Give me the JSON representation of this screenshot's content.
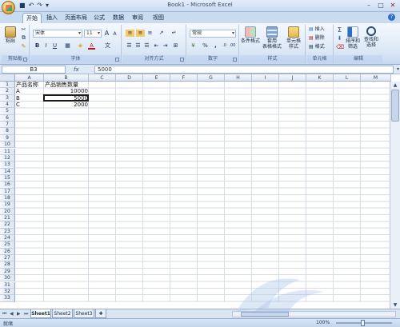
{
  "window": {
    "title": "Book1 - Microsoft Excel"
  },
  "tabs": [
    {
      "label": "开始",
      "active": true
    },
    {
      "label": "插入"
    },
    {
      "label": "页面布局"
    },
    {
      "label": "公式"
    },
    {
      "label": "数据"
    },
    {
      "label": "审阅"
    },
    {
      "label": "视图"
    }
  ],
  "ribbon": {
    "clipboard": {
      "paste": "粘贴",
      "label": "剪贴板"
    },
    "font": {
      "name": "宋体",
      "size": "11",
      "label": "字体",
      "bold": "B",
      "italic": "I",
      "underline": "U",
      "color_a": "A",
      "grow": "A",
      "shrink": "A"
    },
    "alignment": {
      "label": "对齐方式"
    },
    "number": {
      "format": "常规",
      "label": "数字",
      "percent": "%",
      "comma": ","
    },
    "styles": {
      "conditional": "条件格式",
      "table": "套用\n表格格式",
      "cell": "单元格\n样式",
      "label": "样式"
    },
    "cells": {
      "insert": "插入",
      "delete": "删除",
      "format": "格式",
      "label": "单元格"
    },
    "editing": {
      "sum": "Σ",
      "sort": "排序和\n筛选",
      "find": "查找和\n选择",
      "label": "编辑"
    }
  },
  "formula_bar": {
    "name_box": "B3",
    "fx": "fx",
    "value": "5000"
  },
  "grid": {
    "columns": [
      "A",
      "B",
      "C",
      "D",
      "E",
      "F",
      "G",
      "H",
      "I",
      "J",
      "K",
      "L",
      "M"
    ],
    "row_count": 33,
    "rows": [
      {
        "a": "产品名称",
        "b": "产品销售数量"
      },
      {
        "a": "A",
        "b": "10000"
      },
      {
        "a": "B",
        "b": "5000"
      },
      {
        "a": "C",
        "b": "2000"
      }
    ]
  },
  "sheets": [
    "Sheet1",
    "Sheet2",
    "Sheet3"
  ],
  "status": {
    "mode": "就绪",
    "zoom": "100%"
  },
  "colors": {
    "ribbon_blue": "#c9dbf1",
    "accent": "#2c6fc7"
  }
}
